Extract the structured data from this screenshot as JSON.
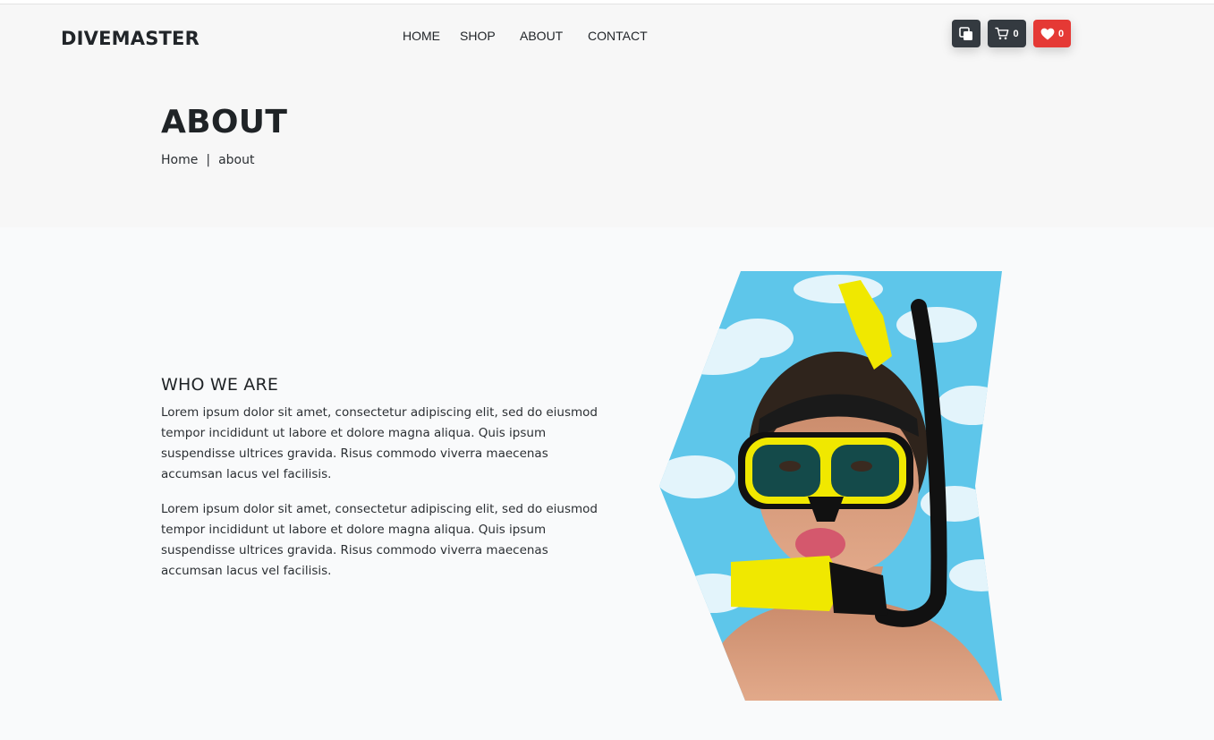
{
  "header": {
    "logo": "DIVEMASTER",
    "nav": [
      {
        "label": "HOME"
      },
      {
        "label": "SHOP"
      },
      {
        "label": "ABOUT"
      },
      {
        "label": "CONTACT"
      }
    ],
    "compare_icon": "compare-icon",
    "cart": {
      "icon": "cart-icon",
      "count": "0",
      "color": "#343a40"
    },
    "wishlist": {
      "icon": "heart-icon",
      "count": "0",
      "color": "#e53935"
    }
  },
  "hero": {
    "title": "ABOUT",
    "breadcrumb": {
      "home": "Home",
      "separator": "|",
      "current": "about"
    }
  },
  "about": {
    "heading": "WHO WE ARE",
    "paragraphs": [
      "Lorem ipsum dolor sit amet, consectetur adipiscing elit, sed do eiusmod tempor incididunt ut labore et dolore magna aliqua. Quis ipsum suspendisse ultrices gravida. Risus commodo viverra maecenas accumsan lacus vel facilisis.",
      "Lorem ipsum dolor sit amet, consectetur adipiscing elit, sed do eiusmod tempor incididunt ut labore et dolore magna aliqua. Quis ipsum suspendisse ultrices gravida. Risus commodo viverra maecenas accumsan lacus vel facilisis."
    ],
    "image": "snorkel-diver-photo"
  }
}
